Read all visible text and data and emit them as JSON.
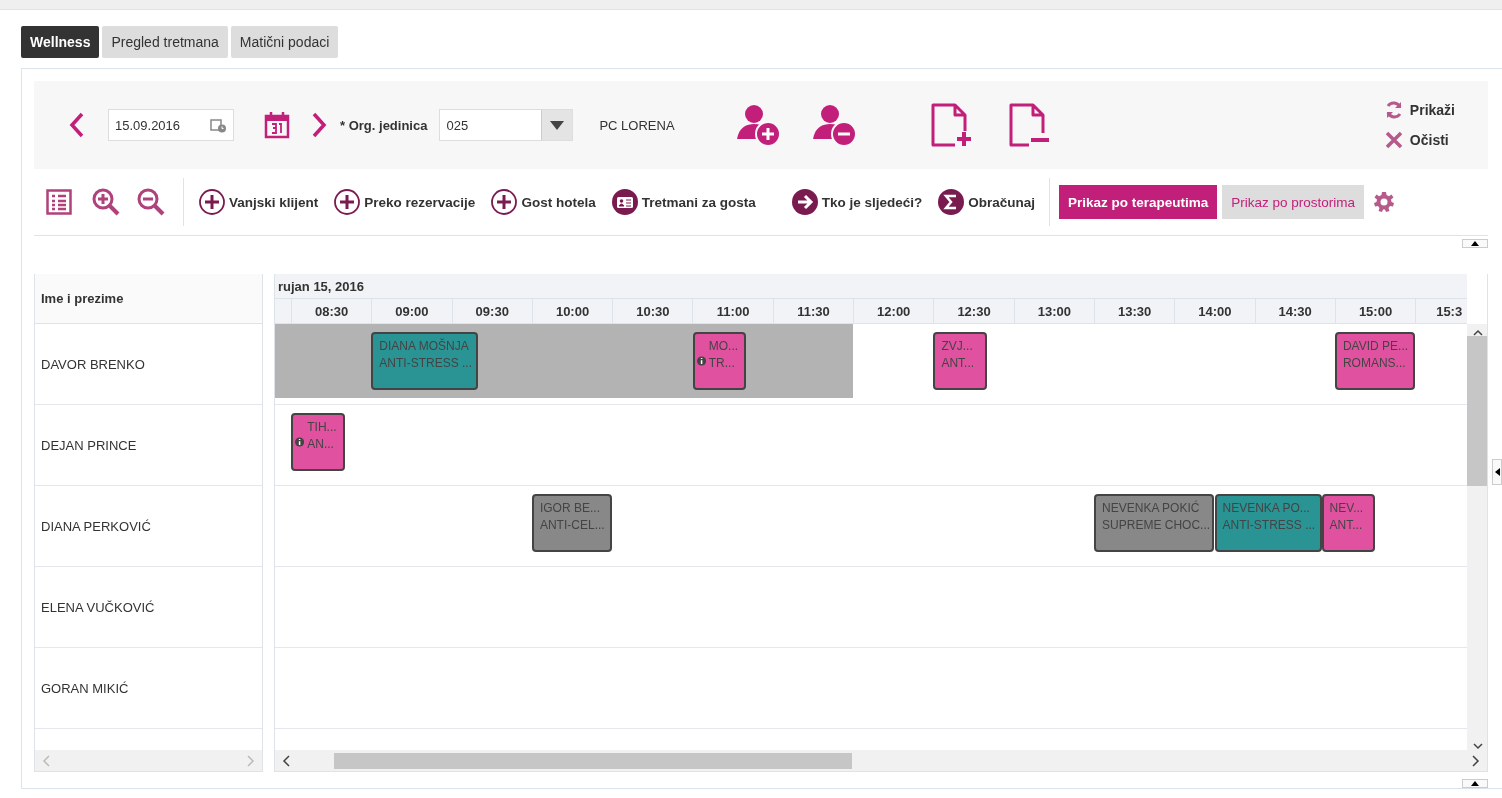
{
  "tabs": [
    {
      "label": "Wellness",
      "selected": true
    },
    {
      "label": "Pregled tretmana",
      "selected": false
    },
    {
      "label": "Matični podaci",
      "selected": false
    }
  ],
  "filter": {
    "date": "15.09.2016",
    "required_mark": "*",
    "org_label": "Org. jedinica",
    "org_value": "025",
    "org_name": "PC LORENA",
    "actions": [
      {
        "kind": "refresh",
        "label": "Prikaži"
      },
      {
        "kind": "clear",
        "label": "Očisti"
      }
    ]
  },
  "toolbar": {
    "buttons": [
      {
        "kind": "plus",
        "label": "Vanjski klijent"
      },
      {
        "kind": "plus",
        "label": "Preko rezervacije"
      },
      {
        "kind": "plus",
        "label": "Gost hotela"
      },
      {
        "kind": "card",
        "label": "Tretmani za gosta"
      },
      {
        "kind": "arrow",
        "label": "Tko je sljedeći?"
      },
      {
        "kind": "sigma",
        "label": "Obračunaj"
      }
    ],
    "views": [
      {
        "label": "Prikaz po terapeutima",
        "selected": true
      },
      {
        "label": "Prikaz po prostorima",
        "selected": false
      }
    ]
  },
  "schedule": {
    "name_header": "Ime i prezime",
    "date": "rujan 15, 2016",
    "slots": [
      "08:30",
      "09:00",
      "09:30",
      "10:00",
      "10:30",
      "11:00",
      "11:30",
      "12:00",
      "12:30",
      "13:00",
      "13:30",
      "14:00",
      "14:30",
      "15:00",
      "15:3"
    ],
    "rows": [
      {
        "name": "DAVOR BRENKO",
        "blocked": true,
        "events": [
          {
            "client": "DIANA MOŠNJA",
            "treatment": "ANTI-STRESS ...",
            "color": "#2a9494",
            "info": false
          },
          {
            "client": "MO...",
            "treatment": "TR...",
            "color": "#e052a0",
            "info": true
          },
          {
            "client": "ZVJ...",
            "treatment": "ANT...",
            "color": "#e052a0",
            "info": false
          },
          {
            "client": "DAVID PE...",
            "treatment": "ROMANS...",
            "color": "#e052a0",
            "info": false
          }
        ]
      },
      {
        "name": "DEJAN PRINCE",
        "blocked": false,
        "events": [
          {
            "client": "TIH...",
            "treatment": "AN...",
            "color": "#e052a0",
            "info": true
          }
        ]
      },
      {
        "name": "DIANA PERKOVIĆ",
        "blocked": false,
        "events": [
          {
            "client": "IGOR BE...",
            "treatment": "ANTI-CEL...",
            "color": "#888888",
            "info": false
          },
          {
            "client": "NEVENKA POKIĆ",
            "treatment": "SUPREME CHOC...",
            "color": "#888888",
            "info": false
          },
          {
            "client": "NEVENKA PO...",
            "treatment": "ANTI-STRESS ...",
            "color": "#2a9494",
            "info": false
          },
          {
            "client": "NEV...",
            "treatment": "ANT...",
            "color": "#e052a0",
            "info": false
          }
        ]
      },
      {
        "name": "ELENA VUČKOVIĆ",
        "blocked": false,
        "events": []
      },
      {
        "name": "GORAN MIKIĆ",
        "blocked": false,
        "events": []
      }
    ]
  }
}
